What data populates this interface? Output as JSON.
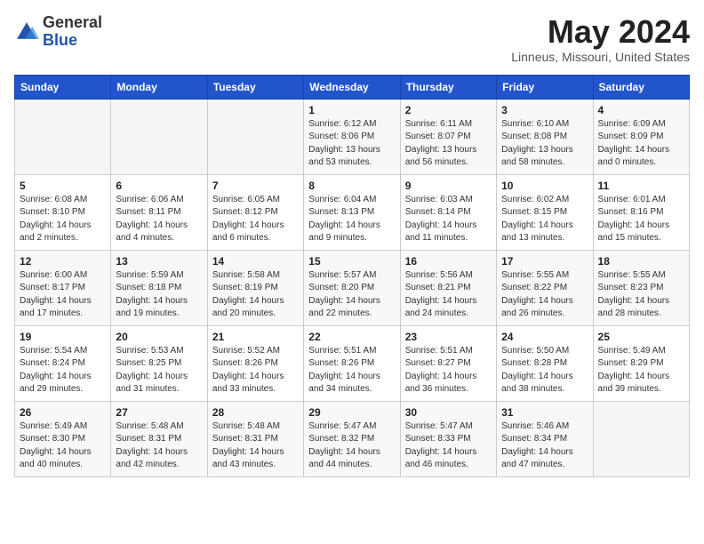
{
  "header": {
    "logo_general": "General",
    "logo_blue": "Blue",
    "month_title": "May 2024",
    "location": "Linneus, Missouri, United States"
  },
  "days_of_week": [
    "Sunday",
    "Monday",
    "Tuesday",
    "Wednesday",
    "Thursday",
    "Friday",
    "Saturday"
  ],
  "weeks": [
    [
      {
        "day": "",
        "info": ""
      },
      {
        "day": "",
        "info": ""
      },
      {
        "day": "",
        "info": ""
      },
      {
        "day": "1",
        "info": "Sunrise: 6:12 AM\nSunset: 8:06 PM\nDaylight: 13 hours and 53 minutes."
      },
      {
        "day": "2",
        "info": "Sunrise: 6:11 AM\nSunset: 8:07 PM\nDaylight: 13 hours and 56 minutes."
      },
      {
        "day": "3",
        "info": "Sunrise: 6:10 AM\nSunset: 8:08 PM\nDaylight: 13 hours and 58 minutes."
      },
      {
        "day": "4",
        "info": "Sunrise: 6:09 AM\nSunset: 8:09 PM\nDaylight: 14 hours and 0 minutes."
      }
    ],
    [
      {
        "day": "5",
        "info": "Sunrise: 6:08 AM\nSunset: 8:10 PM\nDaylight: 14 hours and 2 minutes."
      },
      {
        "day": "6",
        "info": "Sunrise: 6:06 AM\nSunset: 8:11 PM\nDaylight: 14 hours and 4 minutes."
      },
      {
        "day": "7",
        "info": "Sunrise: 6:05 AM\nSunset: 8:12 PM\nDaylight: 14 hours and 6 minutes."
      },
      {
        "day": "8",
        "info": "Sunrise: 6:04 AM\nSunset: 8:13 PM\nDaylight: 14 hours and 9 minutes."
      },
      {
        "day": "9",
        "info": "Sunrise: 6:03 AM\nSunset: 8:14 PM\nDaylight: 14 hours and 11 minutes."
      },
      {
        "day": "10",
        "info": "Sunrise: 6:02 AM\nSunset: 8:15 PM\nDaylight: 14 hours and 13 minutes."
      },
      {
        "day": "11",
        "info": "Sunrise: 6:01 AM\nSunset: 8:16 PM\nDaylight: 14 hours and 15 minutes."
      }
    ],
    [
      {
        "day": "12",
        "info": "Sunrise: 6:00 AM\nSunset: 8:17 PM\nDaylight: 14 hours and 17 minutes."
      },
      {
        "day": "13",
        "info": "Sunrise: 5:59 AM\nSunset: 8:18 PM\nDaylight: 14 hours and 19 minutes."
      },
      {
        "day": "14",
        "info": "Sunrise: 5:58 AM\nSunset: 8:19 PM\nDaylight: 14 hours and 20 minutes."
      },
      {
        "day": "15",
        "info": "Sunrise: 5:57 AM\nSunset: 8:20 PM\nDaylight: 14 hours and 22 minutes."
      },
      {
        "day": "16",
        "info": "Sunrise: 5:56 AM\nSunset: 8:21 PM\nDaylight: 14 hours and 24 minutes."
      },
      {
        "day": "17",
        "info": "Sunrise: 5:55 AM\nSunset: 8:22 PM\nDaylight: 14 hours and 26 minutes."
      },
      {
        "day": "18",
        "info": "Sunrise: 5:55 AM\nSunset: 8:23 PM\nDaylight: 14 hours and 28 minutes."
      }
    ],
    [
      {
        "day": "19",
        "info": "Sunrise: 5:54 AM\nSunset: 8:24 PM\nDaylight: 14 hours and 29 minutes."
      },
      {
        "day": "20",
        "info": "Sunrise: 5:53 AM\nSunset: 8:25 PM\nDaylight: 14 hours and 31 minutes."
      },
      {
        "day": "21",
        "info": "Sunrise: 5:52 AM\nSunset: 8:26 PM\nDaylight: 14 hours and 33 minutes."
      },
      {
        "day": "22",
        "info": "Sunrise: 5:51 AM\nSunset: 8:26 PM\nDaylight: 14 hours and 34 minutes."
      },
      {
        "day": "23",
        "info": "Sunrise: 5:51 AM\nSunset: 8:27 PM\nDaylight: 14 hours and 36 minutes."
      },
      {
        "day": "24",
        "info": "Sunrise: 5:50 AM\nSunset: 8:28 PM\nDaylight: 14 hours and 38 minutes."
      },
      {
        "day": "25",
        "info": "Sunrise: 5:49 AM\nSunset: 8:29 PM\nDaylight: 14 hours and 39 minutes."
      }
    ],
    [
      {
        "day": "26",
        "info": "Sunrise: 5:49 AM\nSunset: 8:30 PM\nDaylight: 14 hours and 40 minutes."
      },
      {
        "day": "27",
        "info": "Sunrise: 5:48 AM\nSunset: 8:31 PM\nDaylight: 14 hours and 42 minutes."
      },
      {
        "day": "28",
        "info": "Sunrise: 5:48 AM\nSunset: 8:31 PM\nDaylight: 14 hours and 43 minutes."
      },
      {
        "day": "29",
        "info": "Sunrise: 5:47 AM\nSunset: 8:32 PM\nDaylight: 14 hours and 44 minutes."
      },
      {
        "day": "30",
        "info": "Sunrise: 5:47 AM\nSunset: 8:33 PM\nDaylight: 14 hours and 46 minutes."
      },
      {
        "day": "31",
        "info": "Sunrise: 5:46 AM\nSunset: 8:34 PM\nDaylight: 14 hours and 47 minutes."
      },
      {
        "day": "",
        "info": ""
      }
    ]
  ]
}
